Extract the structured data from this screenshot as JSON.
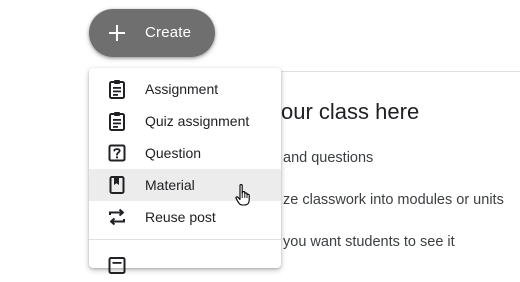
{
  "create_button": {
    "label": "Create",
    "icon": "plus-icon"
  },
  "background": {
    "title": "our class here",
    "lines": [
      "and questions",
      "ze classwork into modules or units",
      "you want students to see it"
    ]
  },
  "menu": {
    "items": [
      {
        "label": "Assignment",
        "icon": "assignment-icon"
      },
      {
        "label": "Quiz assignment",
        "icon": "quiz-assignment-icon"
      },
      {
        "label": "Question",
        "icon": "question-icon"
      },
      {
        "label": "Material",
        "icon": "material-icon",
        "hovered": true
      },
      {
        "label": "Reuse post",
        "icon": "reuse-post-icon"
      }
    ],
    "partial_item_icon": "topic-icon"
  },
  "colors": {
    "create_button_bg": "#6f6f6f",
    "hover_bg": "#ececec",
    "text": "#202124"
  }
}
